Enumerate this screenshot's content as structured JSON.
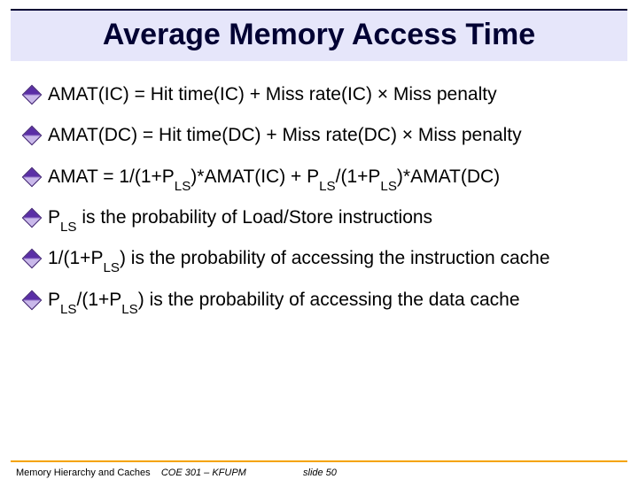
{
  "title": "Average Memory Access Time",
  "bullets": {
    "b1": "AMAT(IC) = Hit time(IC) + Miss rate(IC) × Miss penalty",
    "b2": "AMAT(DC) = Hit time(DC) + Miss rate(DC) × Miss penalty",
    "b3_pre": "AMAT = 1/(1+P",
    "b3_a": ")*AMAT(IC)  + P",
    "b3_b": "/(1+P",
    "b3_c": ")*AMAT(DC)",
    "b4_pre": "P",
    "b4_post": " is the probability of Load/Store instructions",
    "b5_pre": "1/(1+P",
    "b5_post": ") is the probability of accessing the instruction cache",
    "b6_pre": "P",
    "b6_mid": "/(1+P",
    "b6_post": ") is the probability of accessing the data cache",
    "sub_ls": "LS"
  },
  "footer": {
    "topic": "Memory Hierarchy and Caches",
    "course": "COE 301 – KFUPM",
    "slide": "slide 50"
  }
}
